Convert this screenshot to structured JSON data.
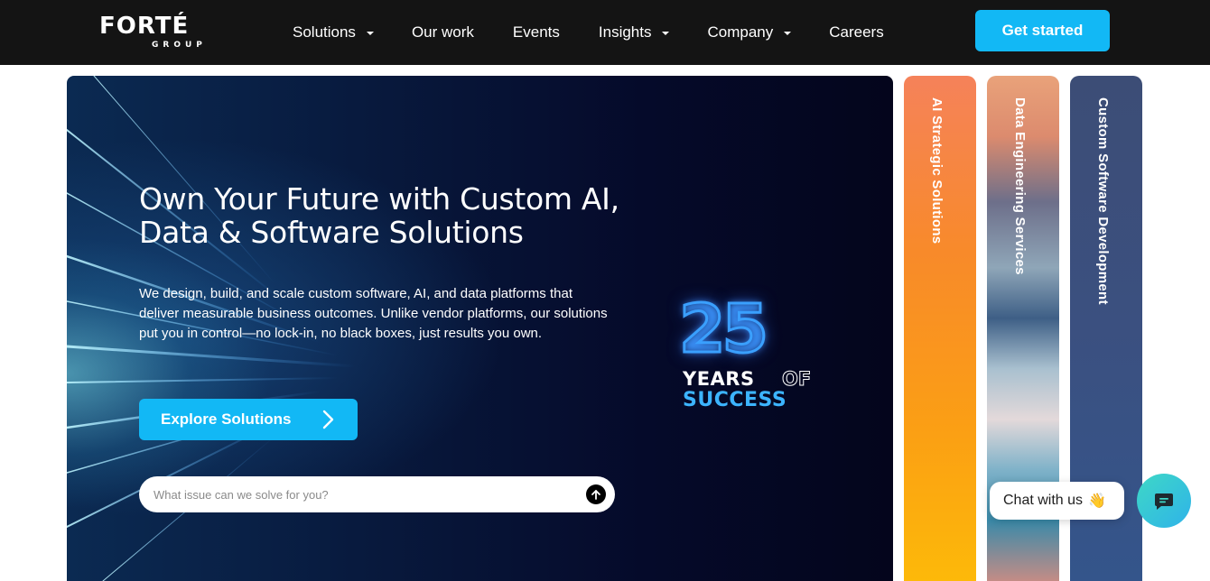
{
  "brand": {
    "name": "FORTÉ",
    "sub": "GROUP"
  },
  "nav": {
    "items": [
      {
        "label": "Solutions",
        "dropdown": true
      },
      {
        "label": "Our work",
        "dropdown": false
      },
      {
        "label": "Events",
        "dropdown": false
      },
      {
        "label": "Insights",
        "dropdown": true
      },
      {
        "label": "Company",
        "dropdown": true
      },
      {
        "label": "Careers",
        "dropdown": false
      }
    ],
    "cta": "Get started"
  },
  "hero": {
    "title": "Own Your Future with Custom AI, Data & Software Solutions",
    "description": "We design, build, and scale custom software, AI, and data platforms that deliver measurable business outcomes. Unlike vendor platforms, our solutions put you in control—no lock-in, no black boxes, just results you own.",
    "button_label": "Explore Solutions",
    "search_placeholder": "What issue can we solve for you?"
  },
  "badge": {
    "number": "25",
    "years": "YEARS",
    "of": "OF",
    "success": "SUCCESS"
  },
  "cards": [
    {
      "label": "AI Strategic Solutions"
    },
    {
      "label": "Data Engineering Services"
    },
    {
      "label": "Custom Software Development"
    }
  ],
  "chat": {
    "label": "Chat with us",
    "emoji": "👋"
  },
  "colors": {
    "accent": "#12b8f5",
    "nav_bg": "#141414",
    "hero_bg": "#050a2a"
  }
}
